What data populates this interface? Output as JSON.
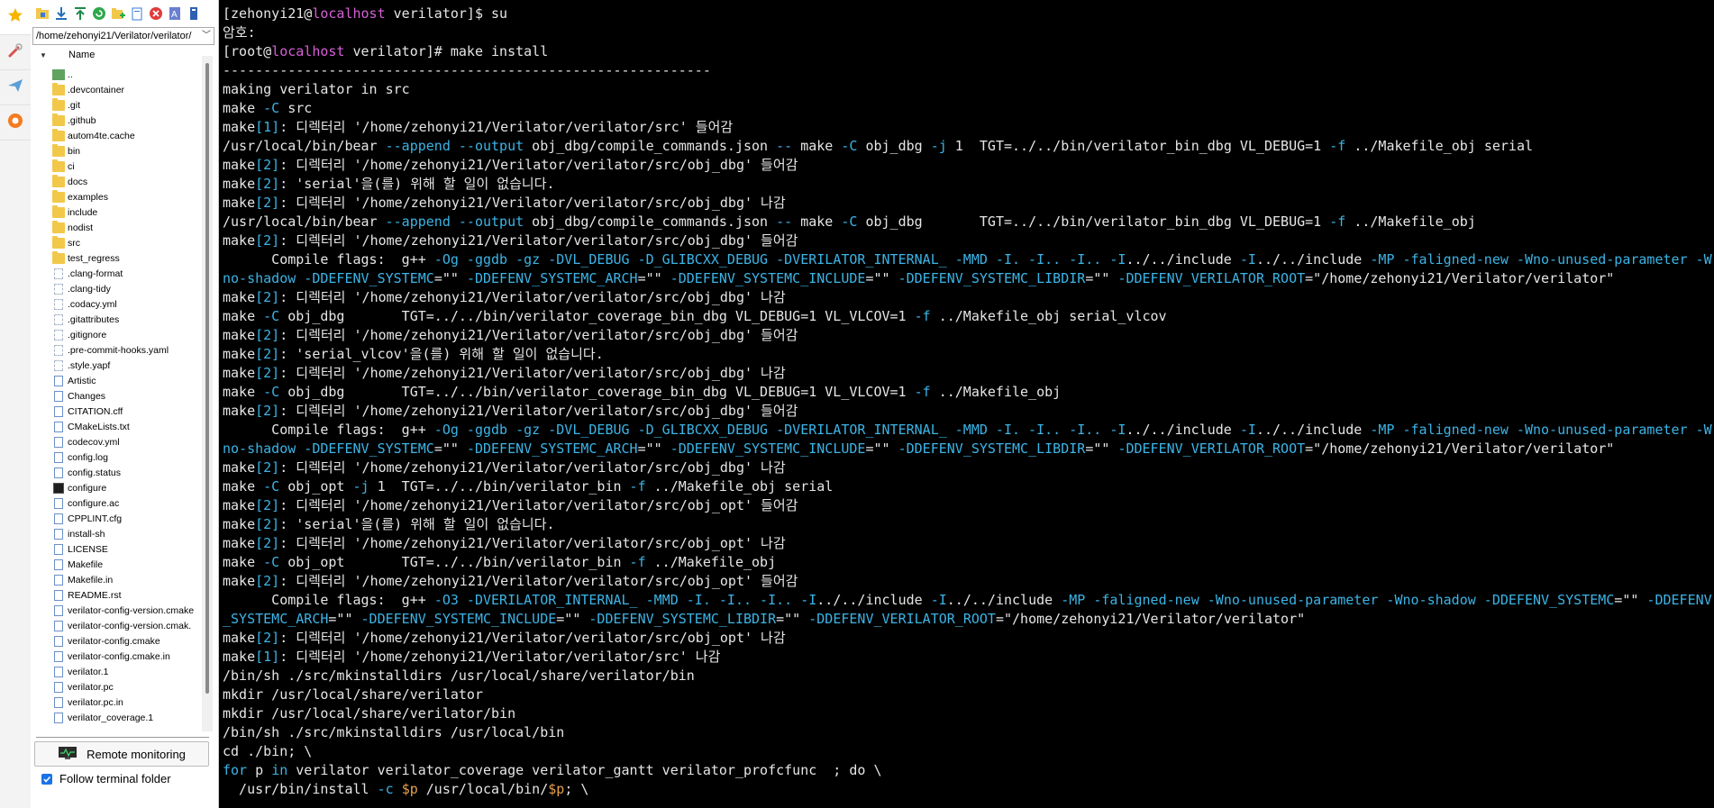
{
  "sidebar_tabs": [
    {
      "icon": "star-icon"
    },
    {
      "icon": "tools-icon"
    },
    {
      "icon": "send-icon"
    },
    {
      "icon": "logo-icon"
    }
  ],
  "toolbar": {
    "icons": [
      "home-folder-icon",
      "download-icon",
      "upload-icon",
      "refresh-icon",
      "new-folder-icon",
      "new-file-icon",
      "delete-icon",
      "rename-icon",
      "properties-icon"
    ]
  },
  "file_panel": {
    "path": "/home/zehonyi21/Verilator/verilator/",
    "column_header": "Name",
    "items": [
      {
        "name": "..",
        "type": "up"
      },
      {
        "name": ".devcontainer",
        "type": "folder"
      },
      {
        "name": ".git",
        "type": "folder"
      },
      {
        "name": ".github",
        "type": "folder"
      },
      {
        "name": "autom4te.cache",
        "type": "folder"
      },
      {
        "name": "bin",
        "type": "folder"
      },
      {
        "name": "ci",
        "type": "folder"
      },
      {
        "name": "docs",
        "type": "folder"
      },
      {
        "name": "examples",
        "type": "folder"
      },
      {
        "name": "include",
        "type": "folder"
      },
      {
        "name": "nodist",
        "type": "folder"
      },
      {
        "name": "src",
        "type": "folder"
      },
      {
        "name": "test_regress",
        "type": "folder"
      },
      {
        "name": ".clang-format",
        "type": "dotfile"
      },
      {
        "name": ".clang-tidy",
        "type": "dotfile"
      },
      {
        "name": ".codacy.yml",
        "type": "dotfile"
      },
      {
        "name": ".gitattributes",
        "type": "dotfile"
      },
      {
        "name": ".gitignore",
        "type": "dotfile"
      },
      {
        "name": ".pre-commit-hooks.yaml",
        "type": "dotfile"
      },
      {
        "name": ".style.yapf",
        "type": "dotfile"
      },
      {
        "name": "Artistic",
        "type": "file"
      },
      {
        "name": "Changes",
        "type": "file"
      },
      {
        "name": "CITATION.cff",
        "type": "file"
      },
      {
        "name": "CMakeLists.txt",
        "type": "file"
      },
      {
        "name": "codecov.yml",
        "type": "file"
      },
      {
        "name": "config.log",
        "type": "file"
      },
      {
        "name": "config.status",
        "type": "file"
      },
      {
        "name": "configure",
        "type": "exe"
      },
      {
        "name": "configure.ac",
        "type": "file"
      },
      {
        "name": "CPPLINT.cfg",
        "type": "file"
      },
      {
        "name": "install-sh",
        "type": "file"
      },
      {
        "name": "LICENSE",
        "type": "file"
      },
      {
        "name": "Makefile",
        "type": "file"
      },
      {
        "name": "Makefile.in",
        "type": "file"
      },
      {
        "name": "README.rst",
        "type": "file"
      },
      {
        "name": "verilator-config-version.cmake",
        "type": "file"
      },
      {
        "name": "verilator-config-version.cmak.",
        "type": "file"
      },
      {
        "name": "verilator-config.cmake",
        "type": "file"
      },
      {
        "name": "verilator-config.cmake.in",
        "type": "file"
      },
      {
        "name": "verilator.1",
        "type": "file"
      },
      {
        "name": "verilator.pc",
        "type": "file"
      },
      {
        "name": "verilator.pc.in",
        "type": "file"
      },
      {
        "name": "verilator_coverage.1",
        "type": "file"
      }
    ],
    "remote_monitoring_label": "Remote monitoring",
    "follow_terminal_label": "Follow terminal folder",
    "follow_terminal_checked": true
  },
  "colors": {
    "terminal_bg": "#000000",
    "terminal_fg": "#e6e6e6",
    "host": "#d75fd7",
    "cyan": "#3cb4e6",
    "orange": "#e8a050"
  },
  "terminal_lines": [
    [
      [
        "t",
        "[zehonyi21@"
      ],
      [
        "h",
        "localhost"
      ],
      [
        "t",
        " verilator]$ su"
      ]
    ],
    [
      [
        "t",
        "암호:"
      ]
    ],
    [
      [
        "t",
        "[root@"
      ],
      [
        "h",
        "localhost"
      ],
      [
        "t",
        " verilator]# make install"
      ]
    ],
    [
      [
        "t",
        "------------------------------------------------------------"
      ]
    ],
    [
      [
        "t",
        "making verilator in src"
      ]
    ],
    [
      [
        "t",
        "make "
      ],
      [
        "c",
        "-C"
      ],
      [
        "t",
        " src"
      ]
    ],
    [
      [
        "t",
        "make"
      ],
      [
        "c",
        "[1]"
      ],
      [
        "t",
        ": 디렉터리 '/home/zehonyi21/Verilator/verilator/src' 들어감"
      ]
    ],
    [
      [
        "t",
        "/usr/local/bin/bear "
      ],
      [
        "c",
        "--append"
      ],
      [
        "t",
        " "
      ],
      [
        "c",
        "--output"
      ],
      [
        "t",
        " obj_dbg/compile_commands.json "
      ],
      [
        "c",
        "--"
      ],
      [
        "t",
        " make "
      ],
      [
        "c",
        "-C"
      ],
      [
        "t",
        " obj_dbg "
      ],
      [
        "c",
        "-j"
      ],
      [
        "t",
        " 1  TGT=../../bin/verilator_bin_dbg VL_DEBUG=1 "
      ],
      [
        "c",
        "-f"
      ],
      [
        "t",
        " ../Makefile_obj serial"
      ]
    ],
    [
      [
        "t",
        "make"
      ],
      [
        "c",
        "[2]"
      ],
      [
        "t",
        ": 디렉터리 '/home/zehonyi21/Verilator/verilator/src/obj_dbg' 들어감"
      ]
    ],
    [
      [
        "t",
        "make"
      ],
      [
        "c",
        "[2]"
      ],
      [
        "t",
        ": 'serial'을(를) 위해 할 일이 없습니다."
      ]
    ],
    [
      [
        "t",
        "make"
      ],
      [
        "c",
        "[2]"
      ],
      [
        "t",
        ": 디렉터리 '/home/zehonyi21/Verilator/verilator/src/obj_dbg' 나감"
      ]
    ],
    [
      [
        "t",
        "/usr/local/bin/bear "
      ],
      [
        "c",
        "--append"
      ],
      [
        "t",
        " "
      ],
      [
        "c",
        "--output"
      ],
      [
        "t",
        " obj_dbg/compile_commands.json "
      ],
      [
        "c",
        "--"
      ],
      [
        "t",
        " make "
      ],
      [
        "c",
        "-C"
      ],
      [
        "t",
        " obj_dbg       TGT=../../bin/verilator_bin_dbg VL_DEBUG=1 "
      ],
      [
        "c",
        "-f"
      ],
      [
        "t",
        " ../Makefile_obj"
      ]
    ],
    [
      [
        "t",
        "make"
      ],
      [
        "c",
        "[2]"
      ],
      [
        "t",
        ": 디렉터리 '/home/zehonyi21/Verilator/verilator/src/obj_dbg' 들어감"
      ]
    ],
    [
      [
        "t",
        "      Compile flags:  g++ "
      ],
      [
        "c",
        "-Og -ggdb -gz -DVL_DEBUG -D_GLIBCXX_DEBUG -DVERILATOR_INTERNAL_ -MMD -I. -I.. -I.. -I"
      ],
      [
        "t",
        "../../include "
      ],
      [
        "c",
        "-I"
      ],
      [
        "t",
        "../../include "
      ],
      [
        "c",
        "-MP -faligned-new -Wno-unused-parameter -W"
      ]
    ],
    [
      [
        "c",
        "no-shadow -DDEFENV_SYSTEMC"
      ],
      [
        "t",
        "=\"\" "
      ],
      [
        "c",
        "-DDEFENV_SYSTEMC_ARCH"
      ],
      [
        "t",
        "=\"\" "
      ],
      [
        "c",
        "-DDEFENV_SYSTEMC_INCLUDE"
      ],
      [
        "t",
        "=\"\" "
      ],
      [
        "c",
        "-DDEFENV_SYSTEMC_LIBDIR"
      ],
      [
        "t",
        "=\"\" "
      ],
      [
        "c",
        "-DDEFENV_VERILATOR_ROOT"
      ],
      [
        "t",
        "=\"/home/zehonyi21/Verilator/verilator\""
      ]
    ],
    [
      [
        "t",
        "make"
      ],
      [
        "c",
        "[2]"
      ],
      [
        "t",
        ": 디렉터리 '/home/zehonyi21/Verilator/verilator/src/obj_dbg' 나감"
      ]
    ],
    [
      [
        "t",
        "make "
      ],
      [
        "c",
        "-C"
      ],
      [
        "t",
        " obj_dbg       TGT=../../bin/verilator_coverage_bin_dbg VL_DEBUG=1 VL_VLCOV=1 "
      ],
      [
        "c",
        "-f"
      ],
      [
        "t",
        " ../Makefile_obj serial_vlcov"
      ]
    ],
    [
      [
        "t",
        "make"
      ],
      [
        "c",
        "[2]"
      ],
      [
        "t",
        ": 디렉터리 '/home/zehonyi21/Verilator/verilator/src/obj_dbg' 들어감"
      ]
    ],
    [
      [
        "t",
        "make"
      ],
      [
        "c",
        "[2]"
      ],
      [
        "t",
        ": 'serial_vlcov'을(를) 위해 할 일이 없습니다."
      ]
    ],
    [
      [
        "t",
        "make"
      ],
      [
        "c",
        "[2]"
      ],
      [
        "t",
        ": 디렉터리 '/home/zehonyi21/Verilator/verilator/src/obj_dbg' 나감"
      ]
    ],
    [
      [
        "t",
        "make "
      ],
      [
        "c",
        "-C"
      ],
      [
        "t",
        " obj_dbg       TGT=../../bin/verilator_coverage_bin_dbg VL_DEBUG=1 VL_VLCOV=1 "
      ],
      [
        "c",
        "-f"
      ],
      [
        "t",
        " ../Makefile_obj"
      ]
    ],
    [
      [
        "t",
        "make"
      ],
      [
        "c",
        "[2]"
      ],
      [
        "t",
        ": 디렉터리 '/home/zehonyi21/Verilator/verilator/src/obj_dbg' 들어감"
      ]
    ],
    [
      [
        "t",
        "      Compile flags:  g++ "
      ],
      [
        "c",
        "-Og -ggdb -gz -DVL_DEBUG -D_GLIBCXX_DEBUG -DVERILATOR_INTERNAL_ -MMD -I. -I.. -I.. -I"
      ],
      [
        "t",
        "../../include "
      ],
      [
        "c",
        "-I"
      ],
      [
        "t",
        "../../include "
      ],
      [
        "c",
        "-MP -faligned-new -Wno-unused-parameter -W"
      ]
    ],
    [
      [
        "c",
        "no-shadow -DDEFENV_SYSTEMC"
      ],
      [
        "t",
        "=\"\" "
      ],
      [
        "c",
        "-DDEFENV_SYSTEMC_ARCH"
      ],
      [
        "t",
        "=\"\" "
      ],
      [
        "c",
        "-DDEFENV_SYSTEMC_INCLUDE"
      ],
      [
        "t",
        "=\"\" "
      ],
      [
        "c",
        "-DDEFENV_SYSTEMC_LIBDIR"
      ],
      [
        "t",
        "=\"\" "
      ],
      [
        "c",
        "-DDEFENV_VERILATOR_ROOT"
      ],
      [
        "t",
        "=\"/home/zehonyi21/Verilator/verilator\""
      ]
    ],
    [
      [
        "t",
        "make"
      ],
      [
        "c",
        "[2]"
      ],
      [
        "t",
        ": 디렉터리 '/home/zehonyi21/Verilator/verilator/src/obj_dbg' 나감"
      ]
    ],
    [
      [
        "t",
        "make "
      ],
      [
        "c",
        "-C"
      ],
      [
        "t",
        " obj_opt "
      ],
      [
        "c",
        "-j"
      ],
      [
        "t",
        " 1  TGT=../../bin/verilator_bin "
      ],
      [
        "c",
        "-f"
      ],
      [
        "t",
        " ../Makefile_obj serial"
      ]
    ],
    [
      [
        "t",
        "make"
      ],
      [
        "c",
        "[2]"
      ],
      [
        "t",
        ": 디렉터리 '/home/zehonyi21/Verilator/verilator/src/obj_opt' 들어감"
      ]
    ],
    [
      [
        "t",
        "make"
      ],
      [
        "c",
        "[2]"
      ],
      [
        "t",
        ": 'serial'을(를) 위해 할 일이 없습니다."
      ]
    ],
    [
      [
        "t",
        "make"
      ],
      [
        "c",
        "[2]"
      ],
      [
        "t",
        ": 디렉터리 '/home/zehonyi21/Verilator/verilator/src/obj_opt' 나감"
      ]
    ],
    [
      [
        "t",
        "make "
      ],
      [
        "c",
        "-C"
      ],
      [
        "t",
        " obj_opt       TGT=../../bin/verilator_bin "
      ],
      [
        "c",
        "-f"
      ],
      [
        "t",
        " ../Makefile_obj"
      ]
    ],
    [
      [
        "t",
        "make"
      ],
      [
        "c",
        "[2]"
      ],
      [
        "t",
        ": 디렉터리 '/home/zehonyi21/Verilator/verilator/src/obj_opt' 들어감"
      ]
    ],
    [
      [
        "t",
        "      Compile flags:  g++ "
      ],
      [
        "c",
        "-O3 -DVERILATOR_INTERNAL_ -MMD -I. -I.. -I.. -I"
      ],
      [
        "t",
        "../../include "
      ],
      [
        "c",
        "-I"
      ],
      [
        "t",
        "../../include "
      ],
      [
        "c",
        "-MP -faligned-new -Wno-unused-parameter -Wno-shadow -DDEFENV_SYSTEMC"
      ],
      [
        "t",
        "=\"\" "
      ],
      [
        "c",
        "-DDEFENV"
      ]
    ],
    [
      [
        "c",
        "_SYSTEMC_ARCH"
      ],
      [
        "t",
        "=\"\" "
      ],
      [
        "c",
        "-DDEFENV_SYSTEMC_INCLUDE"
      ],
      [
        "t",
        "=\"\" "
      ],
      [
        "c",
        "-DDEFENV_SYSTEMC_LIBDIR"
      ],
      [
        "t",
        "=\"\" "
      ],
      [
        "c",
        "-DDEFENV_VERILATOR_ROOT"
      ],
      [
        "t",
        "=\"/home/zehonyi21/Verilator/verilator\""
      ]
    ],
    [
      [
        "t",
        "make"
      ],
      [
        "c",
        "[2]"
      ],
      [
        "t",
        ": 디렉터리 '/home/zehonyi21/Verilator/verilator/src/obj_opt' 나감"
      ]
    ],
    [
      [
        "t",
        "make"
      ],
      [
        "c",
        "[1]"
      ],
      [
        "t",
        ": 디렉터리 '/home/zehonyi21/Verilator/verilator/src' 나감"
      ]
    ],
    [
      [
        "t",
        "/bin/sh ./src/mkinstalldirs /usr/local/share/verilator/bin"
      ]
    ],
    [
      [
        "t",
        "mkdir /usr/local/share/verilator"
      ]
    ],
    [
      [
        "t",
        "mkdir /usr/local/share/verilator/bin"
      ]
    ],
    [
      [
        "t",
        "/bin/sh ./src/mkinstalldirs /usr/local/bin"
      ]
    ],
    [
      [
        "t",
        "cd ./bin; \\"
      ]
    ],
    [
      [
        "c",
        "for"
      ],
      [
        "t",
        " p "
      ],
      [
        "c",
        "in"
      ],
      [
        "t",
        " verilator verilator_coverage verilator_gantt verilator_profcfunc  ; do \\"
      ]
    ],
    [
      [
        "t",
        "  /usr/bin/install "
      ],
      [
        "c",
        "-c"
      ],
      [
        "t",
        " "
      ],
      [
        "o",
        "$p"
      ],
      [
        "t",
        " /usr/local/bin/"
      ],
      [
        "o",
        "$p"
      ],
      [
        "t",
        "; \\"
      ]
    ]
  ]
}
